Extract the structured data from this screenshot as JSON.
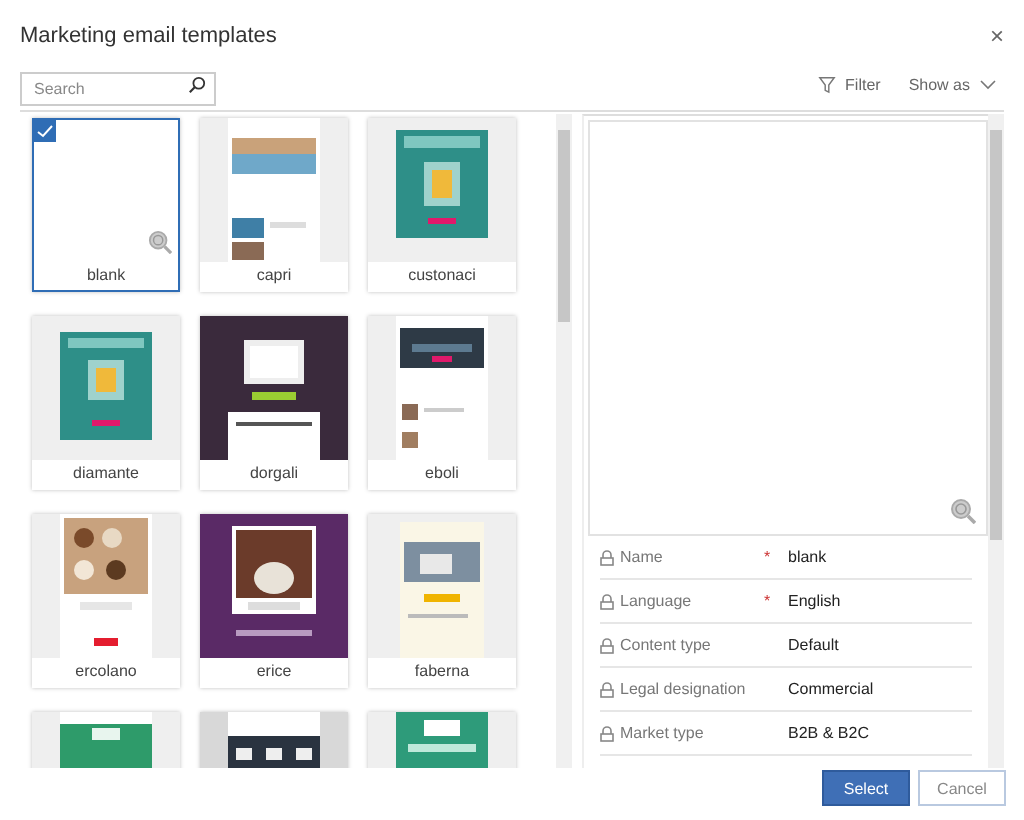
{
  "window": {
    "title": "Marketing email templates",
    "close": "×"
  },
  "search": {
    "placeholder": "Search"
  },
  "toolbar": {
    "filter": "Filter",
    "show_as": "Show as"
  },
  "templates": [
    {
      "name": "blank",
      "kind": "blank",
      "selected": true
    },
    {
      "name": "capri",
      "kind": "picture",
      "selected": false
    },
    {
      "name": "custonaci",
      "kind": "picture",
      "selected": false
    },
    {
      "name": "diamante",
      "kind": "picture",
      "selected": false
    },
    {
      "name": "dorgali",
      "kind": "picture",
      "selected": false
    },
    {
      "name": "eboli",
      "kind": "picture",
      "selected": false
    },
    {
      "name": "ercolano",
      "kind": "picture",
      "selected": false
    },
    {
      "name": "erice",
      "kind": "picture",
      "selected": false
    },
    {
      "name": "faberna",
      "kind": "picture",
      "selected": false
    },
    {
      "kind": "picture",
      "selected": false
    },
    {
      "kind": "picture",
      "selected": false
    },
    {
      "kind": "picture",
      "selected": false
    }
  ],
  "properties": [
    {
      "label": "Name",
      "required_mark": "*",
      "value": "blank"
    },
    {
      "label": "Language",
      "required_mark": "*",
      "value": "English"
    },
    {
      "label": "Content type",
      "value": "Default"
    },
    {
      "label": "Legal designation",
      "value": "Commercial"
    },
    {
      "label": "Market type",
      "value": "B2B & B2C"
    }
  ],
  "buttons": [
    {
      "label": "Select",
      "kind": "primary"
    },
    {
      "label": "Cancel",
      "kind": "secondary"
    }
  ]
}
